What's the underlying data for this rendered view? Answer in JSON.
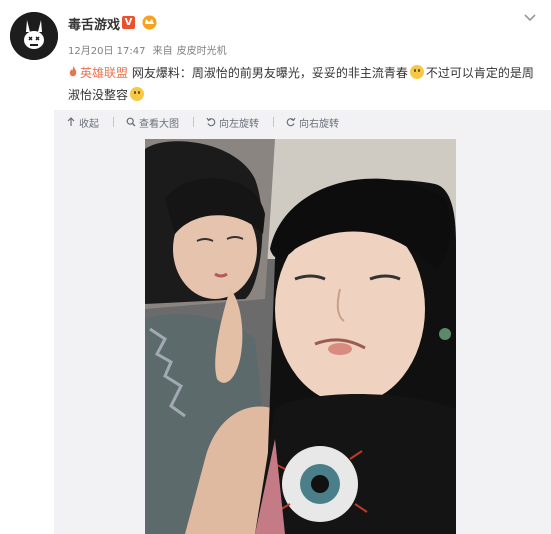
{
  "post": {
    "username": "毒舌游戏",
    "verified_mark": "V",
    "date": "12月20日 17:47",
    "source_prefix": "来自",
    "source": "皮皮时光机",
    "topic": "英雄联盟",
    "text_part1": "网友爆料：周淑怡的前男友曝光，妥妥的非主流青春",
    "text_part2": "不过可以肯定的是周淑怡没整容"
  },
  "toolbar": {
    "collapse": "收起",
    "view_large": "查看大图",
    "rotate_left": "向左旋转",
    "rotate_right": "向右旋转"
  },
  "colors": {
    "topic": "#eb7350",
    "verified": "#e8532d",
    "panel_bg": "#f2f2f5"
  }
}
